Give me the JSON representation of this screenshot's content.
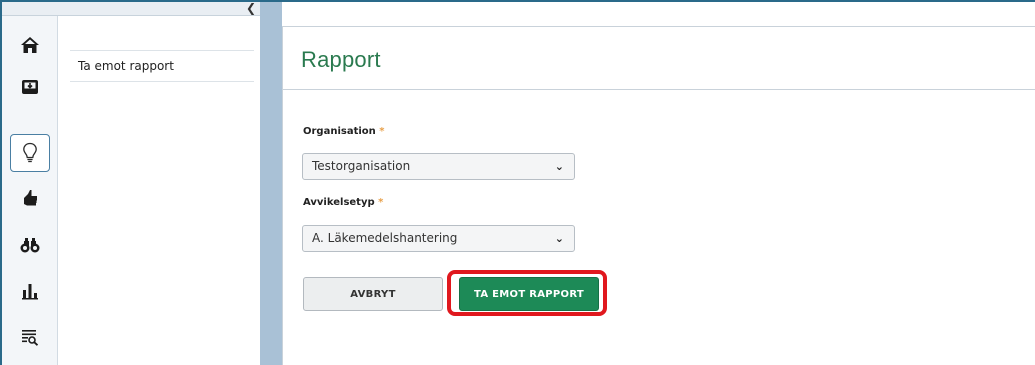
{
  "collapse_icon": "chevron-left-icon",
  "rail": {
    "items": [
      {
        "name": "home-icon"
      },
      {
        "name": "inbox-icon"
      },
      {
        "name": "lightbulb-icon",
        "active": true
      },
      {
        "name": "thumbs-up-icon"
      },
      {
        "name": "binoculars-icon"
      },
      {
        "name": "bar-chart-icon"
      },
      {
        "name": "list-search-icon"
      }
    ]
  },
  "subnav": {
    "items": [
      {
        "label": "Ta emot rapport"
      }
    ]
  },
  "main": {
    "title": "Rapport",
    "organisation": {
      "label": "Organisation",
      "required_mark": "*",
      "value": "Testorganisation"
    },
    "avvikelsetyp": {
      "label": "Avvikelsetyp",
      "required_mark": "*",
      "value": "A. Läkemedelshantering"
    },
    "cancel_label": "AVBRYT",
    "submit_label": "TA EMOT RAPPORT"
  },
  "colors": {
    "accent_green": "#1d8a57",
    "title_green": "#2a7a4f",
    "highlight_red": "#e0181e",
    "splitter_blue": "#a9c1d6"
  }
}
